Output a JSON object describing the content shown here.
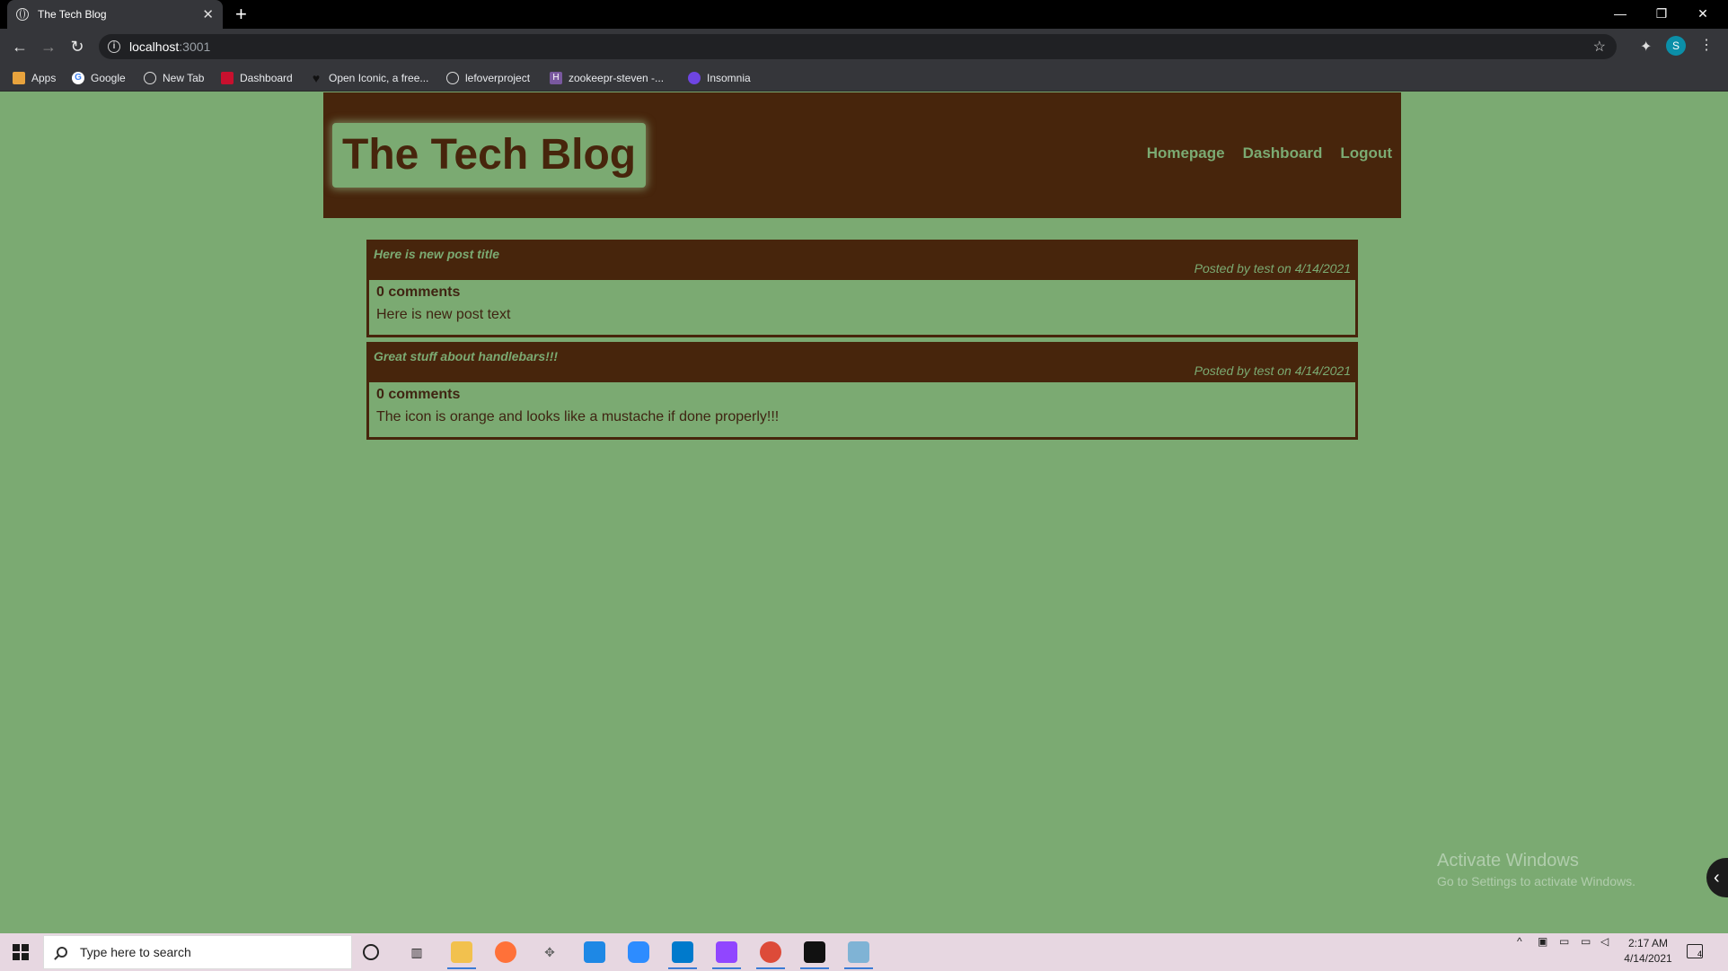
{
  "browser": {
    "tab_title": "The Tech Blog",
    "tab_close": "✕",
    "new_tab": "+",
    "window_controls": {
      "minimize": "—",
      "restore": "❐",
      "close": "✕"
    },
    "nav": {
      "back": "←",
      "forward": "→",
      "reload": "↻"
    },
    "url_host": "localhost",
    "url_port": ":3001",
    "bookmark_star": "☆",
    "extensions_icon": "puzzle-icon",
    "profile_initial": "S",
    "menu": "⋮",
    "bookmarks": [
      {
        "label": "Apps",
        "icon": "apps-grid-icon",
        "color": "#e8a33d"
      },
      {
        "label": "Google",
        "icon": "google-icon",
        "color": "#ffffff"
      },
      {
        "label": "New Tab",
        "icon": "globe-icon",
        "color": "#dddddd"
      },
      {
        "label": "Dashboard",
        "icon": "dashboard-icon",
        "color": "#c8102e"
      },
      {
        "label": "Open Iconic, a free...",
        "icon": "heart-icon",
        "color": "#111111"
      },
      {
        "label": "lefoverproject",
        "icon": "globe-icon",
        "color": "#dddddd"
      },
      {
        "label": "zookeepr-steven -...",
        "icon": "heroku-icon",
        "color": "#79589f"
      },
      {
        "label": "Insomnia",
        "icon": "insomnia-icon",
        "color": "#6e45e2"
      }
    ]
  },
  "site": {
    "title": "The Tech Blog",
    "nav": [
      "Homepage",
      "Dashboard",
      "Logout"
    ],
    "colors": {
      "background": "#7baa72",
      "brown": "#47250c"
    }
  },
  "posts": [
    {
      "title": "Here is new post title",
      "meta": "Posted by test on 4/14/2021",
      "comments": "0 comments",
      "text": "Here is new post text"
    },
    {
      "title": "Great stuff about handlebars!!!",
      "meta": "Posted by test on 4/14/2021",
      "comments": "0 comments",
      "text": "The icon is orange and looks like a mustache if done properly!!!"
    }
  ],
  "watermark": {
    "line1": "Activate Windows",
    "line2": "Go to Settings to activate Windows."
  },
  "taskbar": {
    "search_placeholder": "Type here to search",
    "time": "2:17 AM",
    "date": "4/14/2021",
    "notification_count": "4",
    "apps": [
      {
        "name": "cortana-icon",
        "color": "#222222"
      },
      {
        "name": "task-view-icon",
        "color": "#222222"
      },
      {
        "name": "file-explorer-icon",
        "color": "#f2c14e"
      },
      {
        "name": "firefox-icon",
        "color": "#ff7139"
      },
      {
        "name": "game-controller-icon",
        "color": "#888888"
      },
      {
        "name": "store-icon",
        "color": "#1e88e5"
      },
      {
        "name": "zoom-icon",
        "color": "#2d8cff"
      },
      {
        "name": "vscode-icon",
        "color": "#007acc"
      },
      {
        "name": "twitch-icon",
        "color": "#9146ff"
      },
      {
        "name": "chrome-icon",
        "color": "#dd4b39"
      },
      {
        "name": "terminal-icon",
        "color": "#111111"
      },
      {
        "name": "notepad-icon",
        "color": "#7fb3d5"
      }
    ]
  }
}
